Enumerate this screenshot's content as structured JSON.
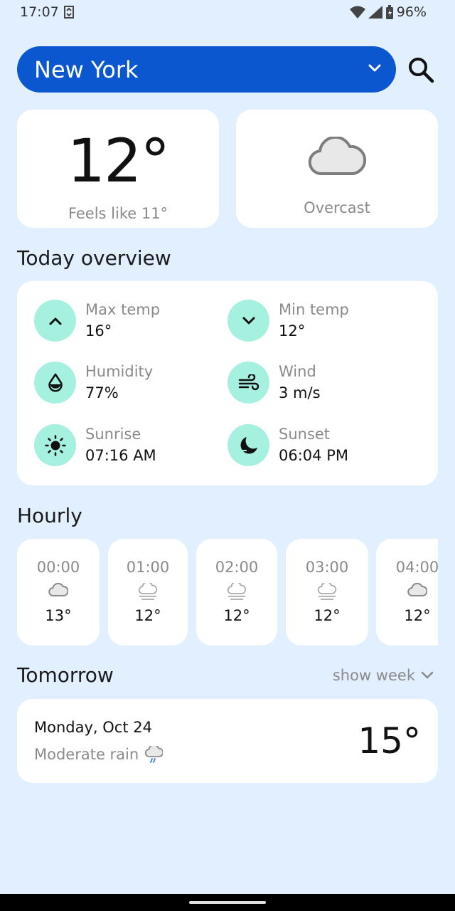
{
  "status": {
    "time": "17:07",
    "battery": "96%"
  },
  "location": {
    "city": "New York"
  },
  "current": {
    "temperature": "12°",
    "feels_like": "Feels like 11°",
    "condition": "Overcast"
  },
  "overview": {
    "title": "Today overview",
    "items": [
      {
        "label": "Max temp",
        "value": "16°",
        "icon": "chevron-up-icon"
      },
      {
        "label": "Min temp",
        "value": "12°",
        "icon": "chevron-down-icon"
      },
      {
        "label": "Humidity",
        "value": "77%",
        "icon": "humidity-icon"
      },
      {
        "label": "Wind",
        "value": "3 m/s",
        "icon": "wind-icon"
      },
      {
        "label": "Sunrise",
        "value": "07:16 AM",
        "icon": "sun-icon"
      },
      {
        "label": "Sunset",
        "value": "06:04 PM",
        "icon": "moon-icon"
      }
    ]
  },
  "hourly": {
    "title": "Hourly",
    "hours": [
      {
        "time": "00:00",
        "temp": "13°",
        "icon": "cloud-icon"
      },
      {
        "time": "01:00",
        "temp": "12°",
        "icon": "fog-icon"
      },
      {
        "time": "02:00",
        "temp": "12°",
        "icon": "fog-icon"
      },
      {
        "time": "03:00",
        "temp": "12°",
        "icon": "fog-icon"
      },
      {
        "time": "04:00",
        "temp": "12°",
        "icon": "cloud-icon"
      }
    ]
  },
  "tomorrow": {
    "title": "Tomorrow",
    "show_week": "show week",
    "date": "Monday, Oct 24",
    "condition": "Moderate rain",
    "temp": "15°"
  }
}
